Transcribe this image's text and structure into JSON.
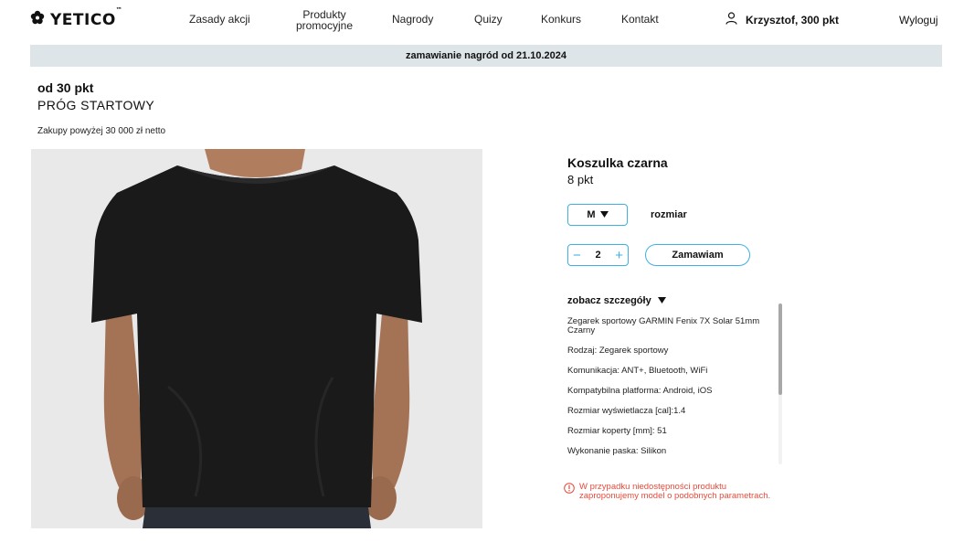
{
  "header": {
    "logo": "YETICO",
    "logo_tm": "™",
    "nav": [
      {
        "label": "Zasady akcji"
      },
      {
        "label": "Produkty promocyjne"
      },
      {
        "label": "Nagrody"
      },
      {
        "label": "Quizy"
      },
      {
        "label": "Konkurs"
      },
      {
        "label": "Kontakt"
      }
    ],
    "user": "Krzysztof, 300 pkt",
    "logout": "Wyloguj"
  },
  "banner": "zamawianie nagród od 21.10.2024",
  "tier": {
    "threshold": "od 30 pkt",
    "name": "PRÓG STARTOWY",
    "condition": "Zakupy powyżej 30 000 zł netto"
  },
  "product": {
    "name": "Koszulka czarna",
    "points": "8 pkt",
    "size_value": "M",
    "size_label": "rozmiar",
    "quantity": "2",
    "order_button": "Zamawiam",
    "details_toggle": "zobacz szczegóły",
    "details": [
      "Zegarek sportowy GARMIN Fenix 7X Solar 51mm Czarny",
      "Rodzaj: Zegarek sportowy",
      "Komunikacja: ANT+, Bluetooth, WiFi",
      "Kompatybilna platforma: Android, iOS",
      "Rozmiar wyświetlacza [cal]:1.4",
      "Rozmiar koperty [mm]: 51",
      "Wykonanie paska: Silikon"
    ],
    "notice": "W przypadku niedostępności produktu zaproponujemy model o podobnych parametrach."
  },
  "colors": {
    "accent": "#3fb0e3",
    "banner_bg": "#dde5e8",
    "warning": "#e84a3a"
  }
}
